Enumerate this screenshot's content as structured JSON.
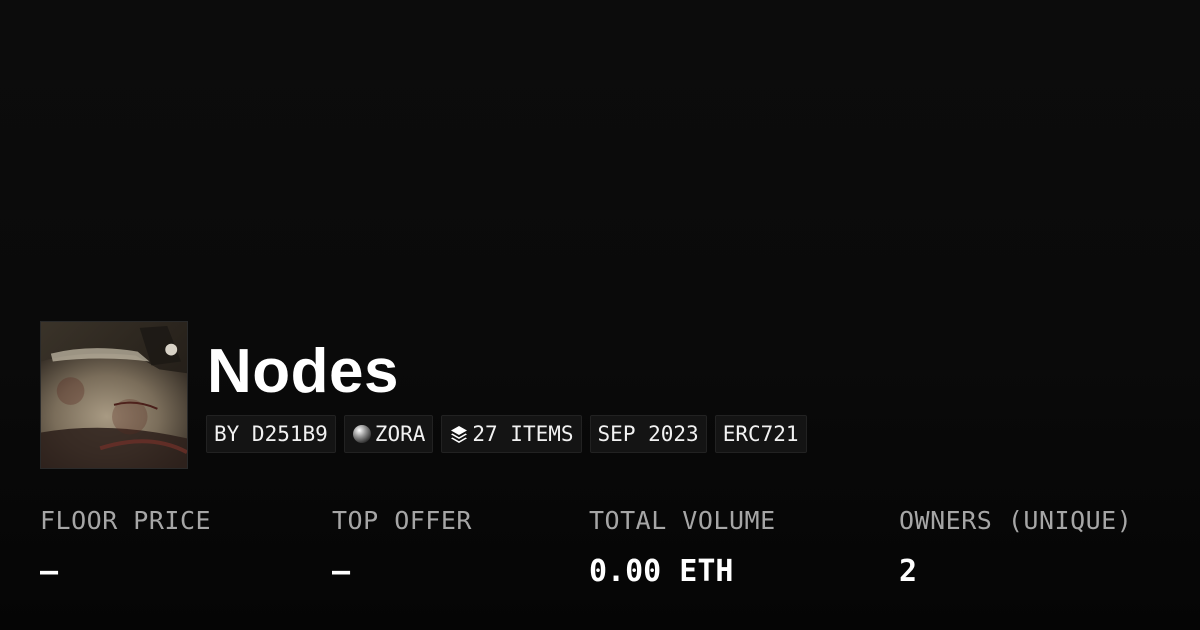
{
  "collection": {
    "name": "Nodes",
    "thumbnail_alt": "collection-thumbnail"
  },
  "badges": [
    {
      "label": "BY D251B9",
      "icon": ""
    },
    {
      "label": "ZORA",
      "icon": "zora-orb-icon"
    },
    {
      "label": "27 ITEMS",
      "icon": "layers-icon"
    },
    {
      "label": "SEP 2023",
      "icon": ""
    },
    {
      "label": "ERC721",
      "icon": ""
    }
  ],
  "stats": [
    {
      "label": "FLOOR PRICE",
      "value": "–"
    },
    {
      "label": "TOP OFFER",
      "value": "–"
    },
    {
      "label": "TOTAL VOLUME",
      "value": "0.00 ETH"
    },
    {
      "label": "OWNERS (UNIQUE)",
      "value": "2"
    }
  ],
  "colors": {
    "background": "#0b0b0b",
    "text": "#ffffff",
    "muted_text": "#a6a6a6",
    "badge_background": "#141414"
  }
}
